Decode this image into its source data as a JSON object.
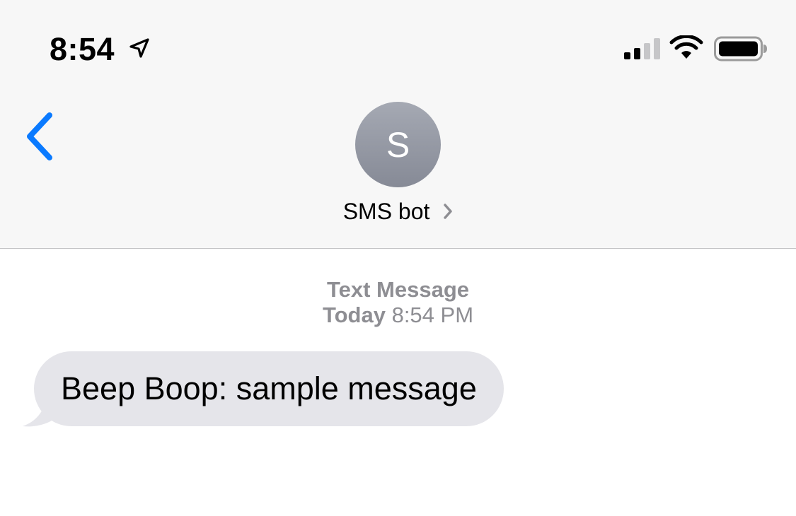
{
  "status_bar": {
    "time": "8:54",
    "icons": [
      "location-arrow-icon",
      "cellular-signal-icon",
      "wifi-icon",
      "battery-icon"
    ]
  },
  "nav": {
    "back_icon": "chevron-left-icon",
    "avatar_initial": "S",
    "contact_name": "SMS bot",
    "contact_chevron_icon": "chevron-right-icon"
  },
  "conversation": {
    "service_label": "Text Message",
    "day_label": "Today",
    "time_label": "8:54 PM",
    "messages": [
      {
        "direction": "incoming",
        "text": "Beep Boop: sample message"
      }
    ]
  },
  "colors": {
    "accent": "#0a7aff",
    "header_bg": "#f7f7f7",
    "bubble_incoming": "#e5e5ea",
    "meta_text": "#8e8e93"
  }
}
